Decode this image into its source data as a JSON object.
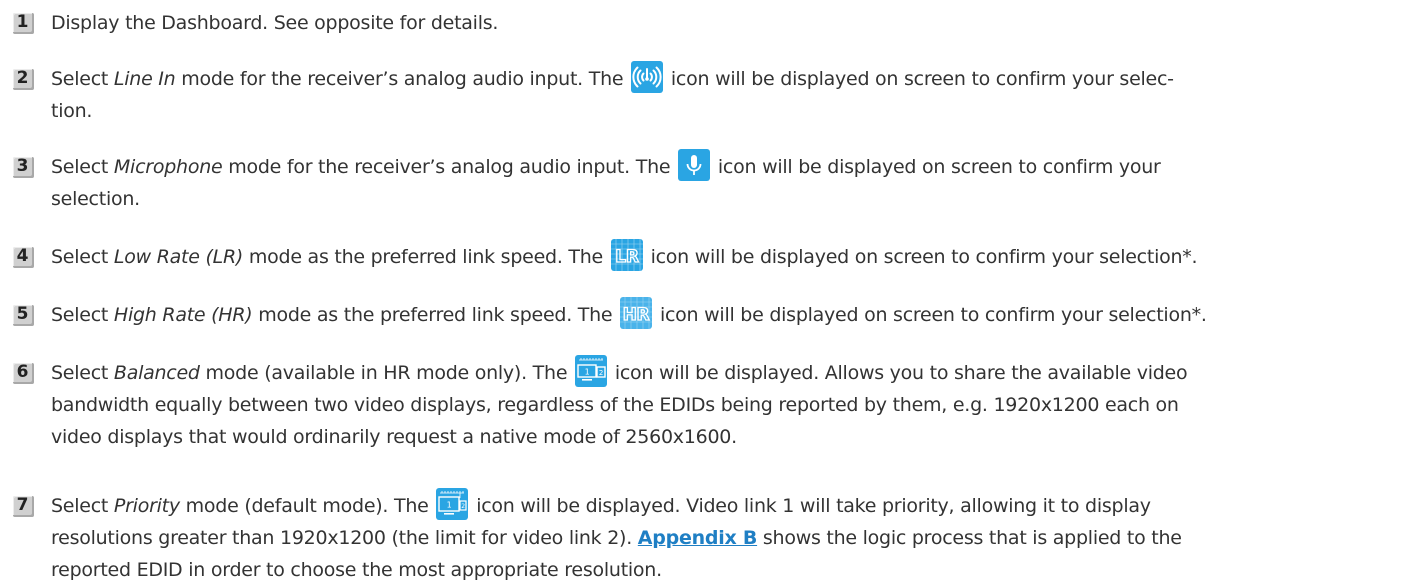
{
  "steps": [
    {
      "num": "1",
      "a": "Display the Dashboard. See opposite for details."
    },
    {
      "num": "2",
      "a": "Select ",
      "em": "Line In",
      "b": " mode for the receiver’s analog audio input. The ",
      "c": " icon will be displayed on screen to confirm your selec-",
      "line2": "tion.",
      "icon": "line-in-icon"
    },
    {
      "num": "3",
      "a": "Select ",
      "em": "Microphone",
      "b": " mode for the receiver’s analog audio input. The ",
      "c": " icon will be displayed on screen to confirm your",
      "line2": "selection.",
      "icon": "microphone-icon"
    },
    {
      "num": "4",
      "a": "Select ",
      "em": "Low Rate (LR)",
      "b": " mode as the preferred link speed. The ",
      "c": " icon will be displayed on screen to confirm your selection*.",
      "icon": "low-rate-icon",
      "icon_text": "LR"
    },
    {
      "num": "5",
      "a": "Select ",
      "em": "High Rate (HR)",
      "b": " mode as the preferred link speed. The ",
      "c": " icon will be displayed on screen to confirm your selection*.",
      "icon": "high-rate-icon",
      "icon_text": "HR"
    },
    {
      "num": "6",
      "a": "Select ",
      "em": "Balanced",
      "b": " mode (available in HR mode only). The ",
      "c": " icon will be displayed. Allows you to share the available video",
      "line2": "bandwidth equally between two video displays, regardless of the EDIDs being reported by them, e.g. 1920x1200 each on",
      "line3": "video displays that would ordinarily request a native mode of 2560x1600.",
      "icon": "balanced-mode-icon"
    },
    {
      "num": "7",
      "a": "Select ",
      "em": "Priority",
      "b": " mode (default mode). The ",
      "c": " icon will be displayed. Video link 1 will take priority, allowing it to display",
      "line2a": "resolutions greater than 1920x1200 (the limit for video link 2). ",
      "link": "Appendix B",
      "line2b": " shows the logic process that is applied to the",
      "line3": "reported EDID in order to choose the most appropriate resolution.",
      "icon": "priority-mode-icon"
    }
  ],
  "icon_digits": {
    "one": "1",
    "two": "2"
  }
}
